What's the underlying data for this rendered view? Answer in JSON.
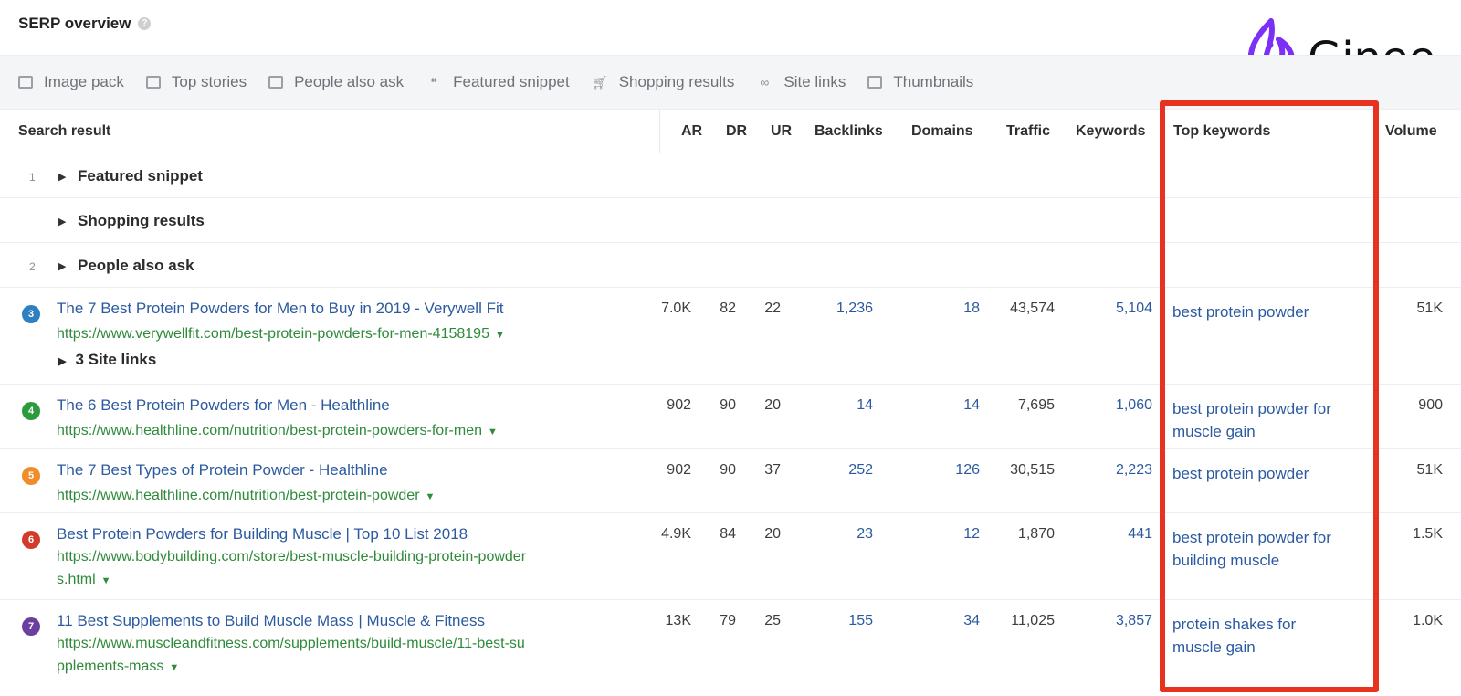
{
  "panel": {
    "title": "SERP overview",
    "help_icon": "question-circle-icon"
  },
  "features": [
    {
      "label": "Image pack",
      "icon": "image-icon"
    },
    {
      "label": "Top stories",
      "icon": "stories-icon"
    },
    {
      "label": "People also ask",
      "icon": "chat-icon"
    },
    {
      "label": "Featured snippet",
      "icon": "quote-icon"
    },
    {
      "label": "Shopping results",
      "icon": "cart-icon"
    },
    {
      "label": "Site links",
      "icon": "link-icon"
    },
    {
      "label": "Thumbnails",
      "icon": "thumbnail-icon"
    }
  ],
  "columns": {
    "search_result": "Search result",
    "ar": "AR",
    "dr": "DR",
    "ur": "UR",
    "backlinks": "Backlinks",
    "domains": "Domains",
    "traffic": "Traffic",
    "keywords": "Keywords",
    "top_keywords": "Top keywords",
    "volume": "Volume"
  },
  "serp_features": [
    {
      "position": "1",
      "label": "Featured snippet"
    },
    {
      "position": "",
      "label": "Shopping results"
    },
    {
      "position": "2",
      "label": "People also ask"
    }
  ],
  "results": [
    {
      "position": "3",
      "badge_color": "#2f7fc1",
      "title": "The 7 Best Protein Powders for Men to Buy in 2019 - Verywell Fit",
      "url_lines": [
        "https://www.verywellfit.com/best-protein-powders-for-men-4158195"
      ],
      "ar": "7.0K",
      "dr": "82",
      "ur": "22",
      "backlinks": "1,236",
      "domains": "18",
      "traffic": "43,574",
      "keywords": "5,104",
      "top_keyword_lines": [
        "best protein powder"
      ],
      "volume": "51K",
      "sitelinks": "3 Site links"
    },
    {
      "position": "4",
      "badge_color": "#2e9a3e",
      "title": "The 6 Best Protein Powders for Men - Healthline",
      "url_lines": [
        "https://www.healthline.com/nutrition/best-protein-powders-for-men"
      ],
      "ar": "902",
      "dr": "90",
      "ur": "20",
      "backlinks": "14",
      "domains": "14",
      "traffic": "7,695",
      "keywords": "1,060",
      "top_keyword_lines": [
        "best protein powder for",
        "muscle gain"
      ],
      "volume": "900"
    },
    {
      "position": "5",
      "badge_color": "#f08c2a",
      "title": "The 7 Best Types of Protein Powder - Healthline",
      "url_lines": [
        "https://www.healthline.com/nutrition/best-protein-powder"
      ],
      "ar": "902",
      "dr": "90",
      "ur": "37",
      "backlinks": "252",
      "domains": "126",
      "traffic": "30,515",
      "keywords": "2,223",
      "top_keyword_lines": [
        "best protein powder"
      ],
      "volume": "51K"
    },
    {
      "position": "6",
      "badge_color": "#d23b2a",
      "title": "Best Protein Powders for Building Muscle | Top 10 List 2018",
      "url_lines": [
        "https://www.bodybuilding.com/store/best-muscle-building-protein-powder",
        "s.html"
      ],
      "ar": "4.9K",
      "dr": "84",
      "ur": "20",
      "backlinks": "23",
      "domains": "12",
      "traffic": "1,870",
      "keywords": "441",
      "top_keyword_lines": [
        "best protein powder for",
        "building muscle"
      ],
      "volume": "1.5K"
    },
    {
      "position": "7",
      "badge_color": "#6a3fa0",
      "title": "11 Best Supplements to Build Muscle Mass | Muscle & Fitness",
      "url_lines": [
        "https://www.muscleandfitness.com/supplements/build-muscle/11-best-su",
        "pplements-mass"
      ],
      "ar": "13K",
      "dr": "79",
      "ur": "25",
      "backlinks": "155",
      "domains": "34",
      "traffic": "11,025",
      "keywords": "3,857",
      "top_keyword_lines": [
        "protein shakes for",
        "muscle gain"
      ],
      "volume": "1.0K"
    }
  ],
  "logo": {
    "text": "Ginee",
    "color": "#7b2ff7"
  },
  "highlight_color": "#e6321e"
}
